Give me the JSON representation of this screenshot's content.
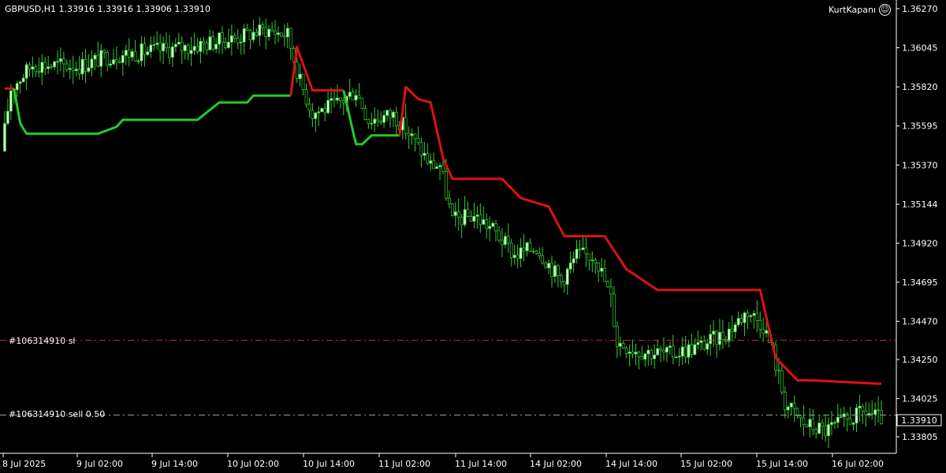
{
  "header": {
    "symbol_info": "GBPUSD,H1  1.33916 1.33916 1.33906 1.33910",
    "brand": "KurtKapanı"
  },
  "orders": {
    "sl_label": "#106314910 sl",
    "entry_label": "#106314910 sell 0.50"
  },
  "price_tag": "1.33910",
  "colors": {
    "background": "#000000",
    "axis": "#ffffff",
    "bull_candle": "#ccffcc",
    "bear_candle": "#000000",
    "wick": "#33cc33",
    "trail_up": "#22cc22",
    "trail_down": "#dd1111",
    "sl_line": "#cc3333",
    "entry_line": "#88aa88"
  },
  "chart_data": {
    "type": "candlestick",
    "y_ticks": [
      "1.36270",
      "1.36045",
      "1.35820",
      "1.35595",
      "1.35370",
      "1.35144",
      "1.34920",
      "1.34695",
      "1.34470",
      "1.34250",
      "1.34025",
      "1.33805"
    ],
    "x_ticks": [
      "8 Jul 2025",
      "9 Jul 02:00",
      "9 Jul 14:00",
      "10 Jul 02:00",
      "10 Jul 14:00",
      "11 Jul 02:00",
      "11 Jul 14:00",
      "14 Jul 02:00",
      "14 Jul 14:00",
      "15 Jul 02:00",
      "15 Jul 14:00",
      "16 Jul 02:00"
    ],
    "ylim": [
      1.3371,
      1.3632
    ],
    "sl_price": 1.3436,
    "entry_price": 1.3393,
    "last_price": 1.3391,
    "trail_levels": [
      [
        0,
        1.3581
      ],
      [
        3,
        1.3581
      ],
      [
        5,
        1.3561
      ],
      [
        7,
        1.3555
      ],
      [
        30,
        1.3555
      ],
      [
        36,
        1.3559
      ],
      [
        38,
        1.3563
      ],
      [
        62,
        1.3563
      ],
      [
        69,
        1.3573
      ],
      [
        78,
        1.3573
      ],
      [
        80,
        1.3577
      ],
      [
        91,
        1.3577
      ],
      [
        92,
        1.3577
      ],
      [
        94,
        1.3605
      ],
      [
        99,
        1.358
      ],
      [
        108,
        1.358
      ],
      [
        109,
        1.358
      ],
      [
        113,
        1.3549
      ],
      [
        115,
        1.3549
      ],
      [
        118,
        1.3554
      ],
      [
        126,
        1.3554
      ],
      [
        127,
        1.3554
      ],
      [
        129,
        1.3582
      ],
      [
        133,
        1.3575
      ],
      [
        137,
        1.3573
      ],
      [
        141,
        1.3541
      ],
      [
        144,
        1.3529
      ],
      [
        160,
        1.3529
      ],
      [
        166,
        1.3518
      ],
      [
        175,
        1.3513
      ],
      [
        180,
        1.3496
      ],
      [
        193,
        1.3496
      ],
      [
        200,
        1.3477
      ],
      [
        210,
        1.3465
      ],
      [
        243,
        1.3465
      ],
      [
        248,
        1.3426
      ],
      [
        255,
        1.3413
      ],
      [
        260,
        1.3413
      ],
      [
        282,
        1.3411
      ]
    ],
    "trail_colors": [
      [
        0,
        3,
        "down"
      ],
      [
        3,
        92,
        "up"
      ],
      [
        92,
        109,
        "down"
      ],
      [
        109,
        127,
        "up"
      ],
      [
        127,
        282,
        "down"
      ]
    ],
    "candle_count": 283
  }
}
